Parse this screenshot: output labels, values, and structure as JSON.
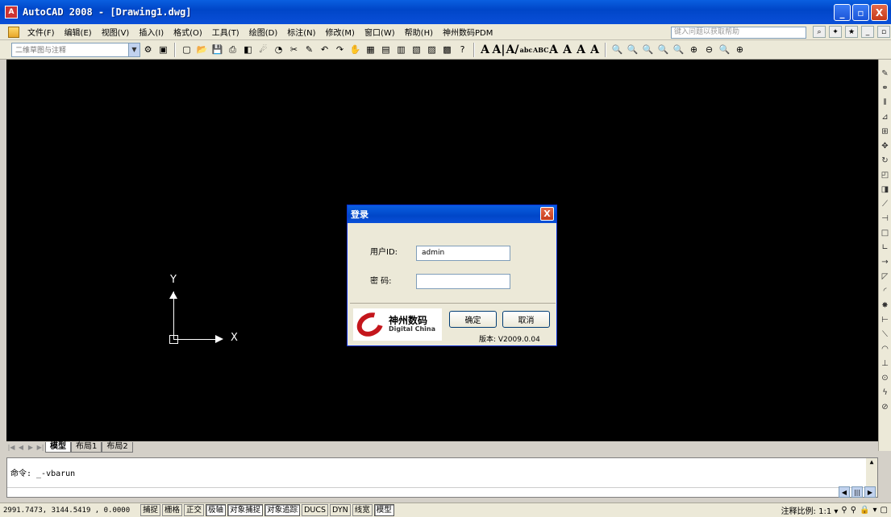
{
  "window": {
    "app_icon_text": "A",
    "title": "AutoCAD 2008 - [Drawing1.dwg]",
    "controls": {
      "minimize": "_",
      "maximize": "▫",
      "close": "X"
    }
  },
  "menubar": {
    "items": [
      "文件(F)",
      "编辑(E)",
      "视图(V)",
      "插入(I)",
      "格式(O)",
      "工具(T)",
      "绘图(D)",
      "标注(N)",
      "修改(M)",
      "窗口(W)",
      "帮助(H)",
      "神州数码PDM"
    ],
    "help_search_placeholder": "键入问题以获取帮助"
  },
  "toolbar": {
    "workspace": "二维草图与注释",
    "text_icons": [
      "A",
      "A|",
      "A/",
      "abc",
      "ABC",
      "A",
      "A",
      "A",
      "A"
    ]
  },
  "canvas": {
    "background": "#000000",
    "ucs": {
      "x_label": "X",
      "y_label": "Y"
    }
  },
  "layout_tabs": {
    "nav": [
      "|◀",
      "◀",
      "▶",
      "▶|"
    ],
    "tabs": [
      {
        "label": "模型",
        "active": true
      },
      {
        "label": "布局1",
        "active": false
      },
      {
        "label": "布局2",
        "active": false
      }
    ]
  },
  "command": {
    "history_line": "命令: _-vbarun",
    "input": ""
  },
  "statusbar": {
    "coords": "2991.7473, 3144.5419 , 0.0000",
    "toggles": [
      {
        "label": "捕捉",
        "on": false
      },
      {
        "label": "栅格",
        "on": false
      },
      {
        "label": "正交",
        "on": false
      },
      {
        "label": "极轴",
        "on": true
      },
      {
        "label": "对象捕捉",
        "on": true
      },
      {
        "label": "对象追踪",
        "on": true
      },
      {
        "label": "DUCS",
        "on": false
      },
      {
        "label": "DYN",
        "on": false
      },
      {
        "label": "线宽",
        "on": false
      },
      {
        "label": "模型",
        "on": true
      }
    ],
    "annotation_scale": "注释比例: 1:1 ▾"
  },
  "login_dialog": {
    "title": "登录",
    "close": "X",
    "user_label": "用户ID:",
    "user_value": "admin",
    "password_label": "密  码:",
    "password_value": "",
    "ok_label": "确定",
    "cancel_label": "取消",
    "version": "版本: V2009.0.04",
    "logo_cn": "神州数码",
    "logo_en": "Digital China"
  }
}
